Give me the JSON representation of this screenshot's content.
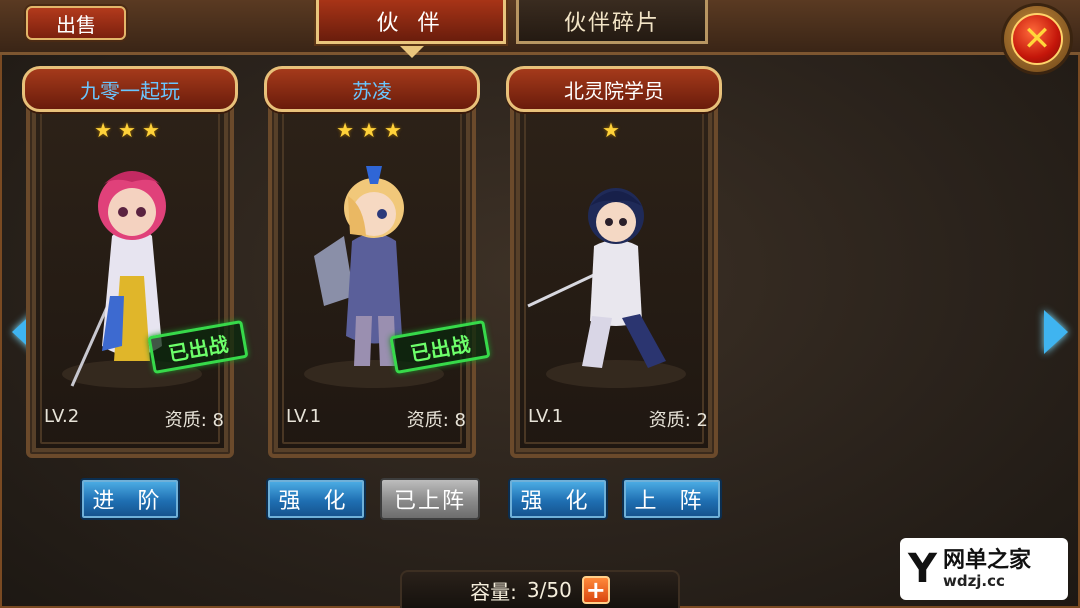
{
  "header": {
    "sell_label": "出售",
    "tabs": [
      {
        "label": "伙 伴",
        "active": true
      },
      {
        "label": "伙伴碎片",
        "active": false
      }
    ]
  },
  "cards": [
    {
      "name": "九零一起玩",
      "name_color": "#6ac6ff",
      "stars": "★★★",
      "star_count": 3,
      "level": "LV.2",
      "aptitude": "资质: 8",
      "deployed_stamp": "已出战"
    },
    {
      "name": "苏凌",
      "name_color": "#6ac6ff",
      "stars": "★★★",
      "star_count": 3,
      "level": "LV.1",
      "aptitude": "资质: 8",
      "deployed_stamp": "已出战"
    },
    {
      "name": "北灵院学员",
      "name_color": "#ffffff",
      "stars": "★",
      "star_count": 1,
      "level": "LV.1",
      "aptitude": "资质: 2",
      "deployed_stamp": ""
    }
  ],
  "actions": {
    "advance_label": "进 阶",
    "strengthen_label_1": "强 化",
    "deployed_label": "已上阵",
    "strengthen_label_2": "强 化",
    "deploy_label": "上 阵"
  },
  "capacity": {
    "label": "容量:",
    "value": "3/50",
    "add_icon": "+"
  },
  "watermark": {
    "cn": "网单之家",
    "url": "wdzj.cc",
    "mark": "Y"
  },
  "colors": {
    "accent_red": "#a53a1b",
    "gold": "#e8c17a",
    "button_blue": "#1f6fb2",
    "stamp_green": "#37d94a"
  }
}
